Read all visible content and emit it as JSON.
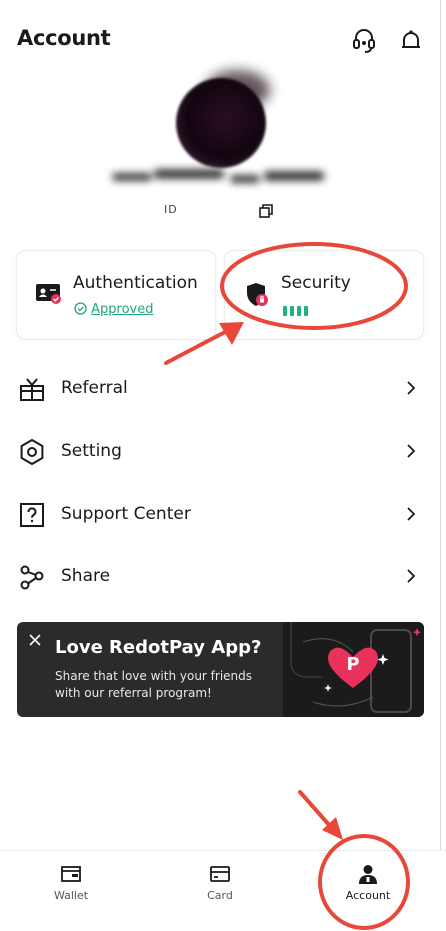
{
  "header": {
    "title": "Account",
    "support_icon": "headset-icon",
    "notification_icon": "bell-icon"
  },
  "profile": {
    "uid_text": "ID",
    "copy_icon": "copy-icon"
  },
  "cards": {
    "authentication": {
      "label": "Authentication",
      "status": "Approved",
      "icon": "id-card-icon"
    },
    "security": {
      "label": "Security",
      "icon": "shield-icon",
      "strength_level": 4
    }
  },
  "menu": [
    {
      "label": "Referral",
      "icon": "gift-icon"
    },
    {
      "label": "Setting",
      "icon": "hexagon-settings-icon"
    },
    {
      "label": "Support Center",
      "icon": "question-box-icon"
    },
    {
      "label": "Share",
      "icon": "share-nodes-icon"
    }
  ],
  "banner": {
    "title": "Love RedotPay App?",
    "description": "Share that love with your friends with our referral program!",
    "logo_letter": "P"
  },
  "tabbar": {
    "tabs": [
      {
        "label": "Wallet",
        "icon": "wallet-icon"
      },
      {
        "label": "Card",
        "icon": "card-icon"
      },
      {
        "label": "Account",
        "icon": "person-icon",
        "active": true
      }
    ]
  },
  "colors": {
    "accent_green": "#22b07d",
    "annotation_red": "#e8473a",
    "brand_pink": "#e8315b",
    "banner_bg": "#2b2b2b"
  }
}
